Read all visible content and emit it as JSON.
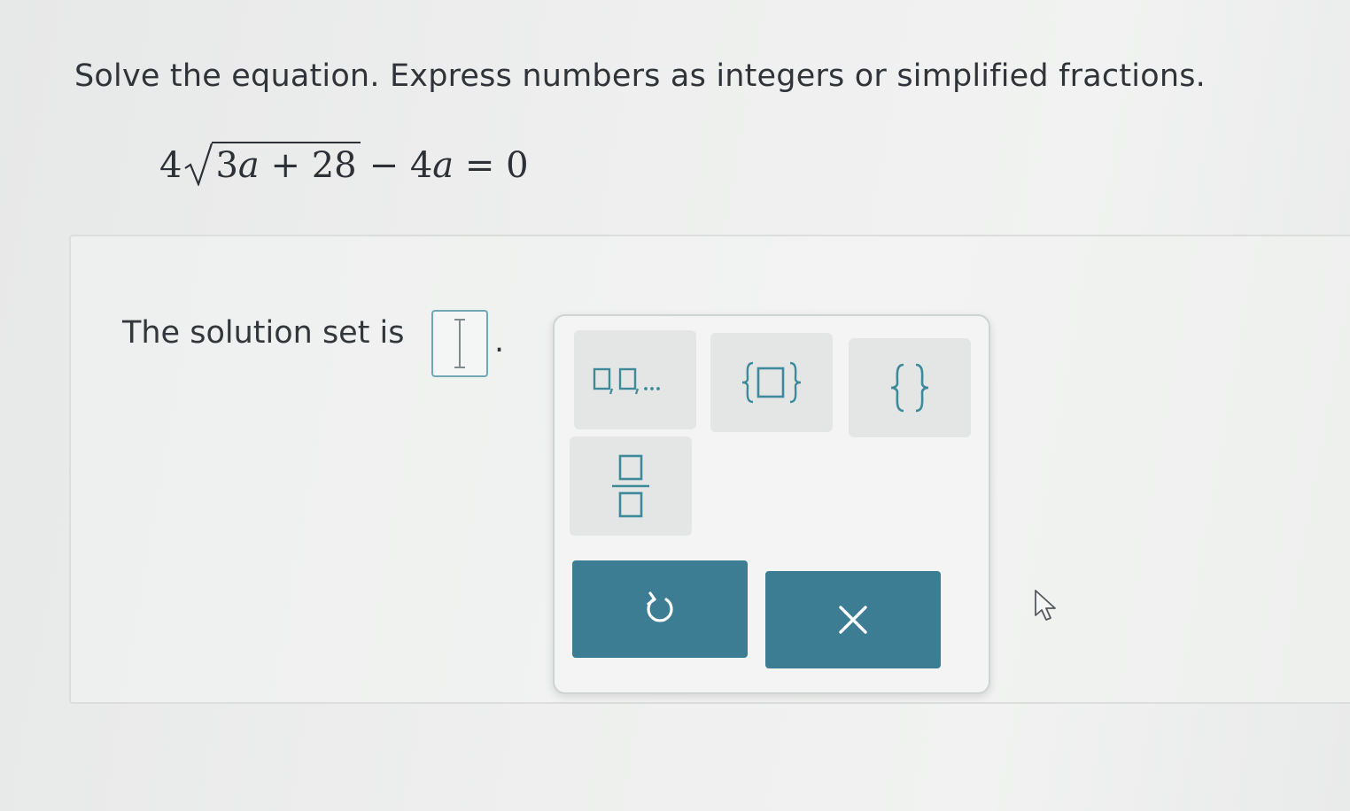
{
  "question": {
    "instructions": "Solve the equation. Express numbers as integers or simplified fractions.",
    "equation": {
      "coefficient": "4",
      "radicand_number": "3",
      "radicand_variable": "a",
      "radicand_plus": " + 28",
      "rest_prefix": "− 4",
      "rest_variable": "a",
      "rest_suffix": " = 0"
    }
  },
  "answer": {
    "label": "The solution set is",
    "input_value": "",
    "period": "."
  },
  "palette": {
    "tools": [
      {
        "name": "list",
        "icon": "list-icon"
      },
      {
        "name": "set with element",
        "icon": "set-box-icon"
      },
      {
        "name": "empty set",
        "icon": "braces-icon"
      },
      {
        "name": "fraction",
        "icon": "fraction-icon"
      }
    ],
    "actions": [
      {
        "name": "undo",
        "icon": "undo-icon"
      },
      {
        "name": "clear",
        "icon": "close-icon"
      }
    ]
  },
  "colors": {
    "accent": "#3d8a9a",
    "action_button": "#3d7d94",
    "answer_box_border": "#6fa8b4",
    "text": "#303338"
  }
}
